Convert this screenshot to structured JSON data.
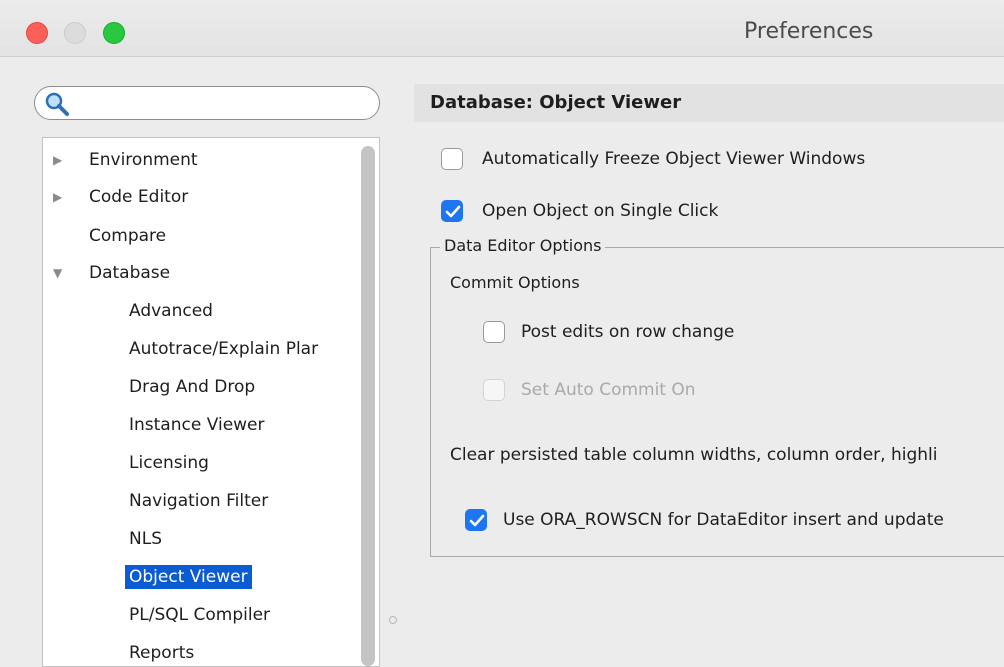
{
  "window": {
    "title": "Preferences"
  },
  "search": {
    "value": "",
    "placeholder": ""
  },
  "tree": {
    "items": [
      {
        "label": "Environment",
        "arrow": "▶"
      },
      {
        "label": "Code Editor",
        "arrow": "▶"
      },
      {
        "label": "Compare",
        "arrow": ""
      },
      {
        "label": "Database",
        "arrow": "▼"
      },
      {
        "label": "Advanced"
      },
      {
        "label": "Autotrace/Explain Plar"
      },
      {
        "label": "Drag And Drop"
      },
      {
        "label": "Instance Viewer"
      },
      {
        "label": "Licensing"
      },
      {
        "label": "Navigation Filter"
      },
      {
        "label": "NLS"
      },
      {
        "label": "Object Viewer"
      },
      {
        "label": "PL/SQL Compiler"
      },
      {
        "label": "Reports"
      }
    ]
  },
  "pane": {
    "title": "Database: Object Viewer",
    "auto_freeze": {
      "label": "Automatically Freeze Object Viewer Windows",
      "checked": false
    },
    "open_single_click": {
      "label": "Open Object on Single Click",
      "checked": true
    },
    "group_title": "Data Editor Options",
    "commit_options": "Commit Options",
    "post_edits": {
      "label": "Post edits on row change",
      "checked": false
    },
    "auto_commit": {
      "label": "Set Auto Commit On",
      "checked": false,
      "disabled": true
    },
    "clear_persisted": "Clear persisted table column widths, column order, highli",
    "ora_rowscn": {
      "label": "Use ORA_ROWSCN for DataEditor insert and update",
      "checked": true
    }
  },
  "colors": {
    "accent": "#1d76f0",
    "selection": "#0b5bd3",
    "close": "#fc5f57",
    "maximize": "#29c840"
  }
}
